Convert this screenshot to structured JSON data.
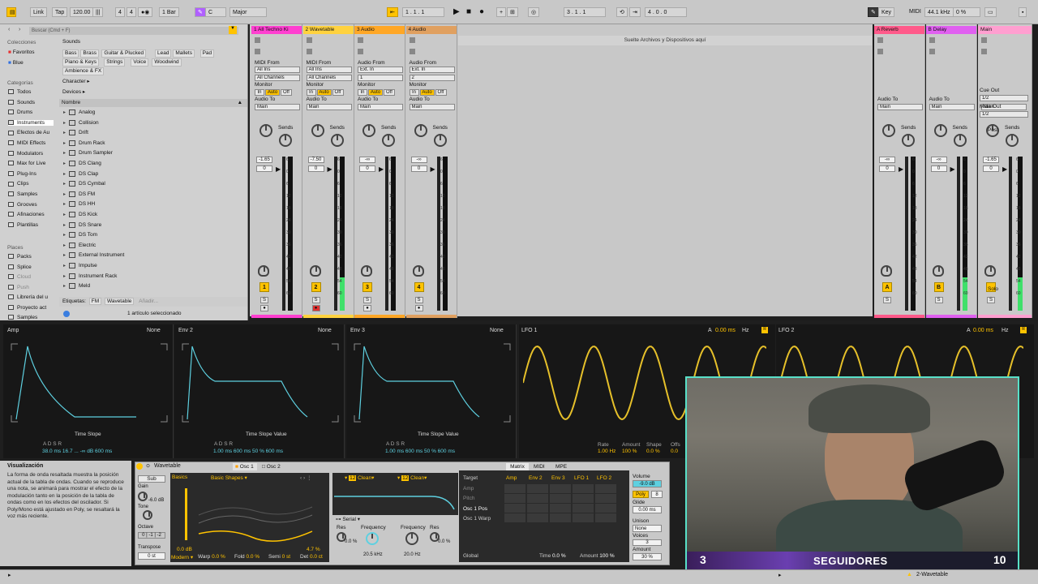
{
  "topbar": {
    "link": "Link",
    "tap": "Tap",
    "tempo": "120.00",
    "meter_num": "4",
    "meter_den": "4",
    "quant": "1 Bar",
    "key": "C",
    "scale": "Major",
    "pos1": "1 .    1 .    1",
    "pos2": "3 .    1 .    1",
    "pos3": "4 .    0 .    0",
    "key_label": "Key",
    "midi_label": "MIDI",
    "samplerate": "44.1 kHz",
    "cpu": "0 %"
  },
  "browser": {
    "search_placeholder": "Buscar (Cmd + F)",
    "headers": {
      "colecciones": "Colecciones",
      "categorias": "Categorías",
      "places": "Places"
    },
    "collections": [
      "Favoritos",
      "Blue"
    ],
    "collection_colors": [
      "#e83030",
      "#3070e0"
    ],
    "categories": [
      "Todos",
      "Sounds",
      "Drums",
      "Instruments",
      "Efectos de Au",
      "MIDI Effects",
      "Modulators",
      "Max for Live",
      "Plug-Ins",
      "Clips",
      "Samples",
      "Grooves",
      "Afinaciones",
      "Plantillas"
    ],
    "places": [
      "Packs",
      "Splice",
      "Cloud",
      "Push",
      "Librería del u",
      "Proyecto act",
      "Samples"
    ],
    "sounds_label": "Sounds",
    "chips_row1": [
      "Bass",
      "Brass",
      "Guitar & Plucked",
      "Lead",
      "Mallets",
      "Pad"
    ],
    "chips_row2": [
      "Piano & Keys",
      "Strings",
      "Voice",
      "Woodwind"
    ],
    "chips_row3": [
      "Ambience & FX"
    ],
    "character": "Character",
    "devices": "Devices",
    "name_col": "Nombre",
    "items": [
      "Analog",
      "Collision",
      "Drift",
      "Drum Rack",
      "Drum Sampler",
      "DS Clang",
      "DS Clap",
      "DS Cymbal",
      "DS FM",
      "DS HH",
      "DS Kick",
      "DS Snare",
      "DS Tom",
      "Electric",
      "External Instrument",
      "Impulse",
      "Instrument Rack",
      "Meld"
    ],
    "tags_label": "Etiquetas:",
    "tag1": "FM",
    "tag2": "Wavetable",
    "tag_add": "Añadir...",
    "selected": "1 artículo seleccionado"
  },
  "session": {
    "dropzone": "Suelte Archivos y Dispositivos aquí",
    "tracks": [
      {
        "name": "1 All Techno Ki",
        "color": "#ff3fd0",
        "from_label": "MIDI From",
        "from": "All Ins",
        "ch": "All Channels",
        "vol": "-1.65",
        "pan": "0",
        "num": "1"
      },
      {
        "name": "2 Wavetable",
        "color": "#ffd23f",
        "from_label": "MIDI From",
        "from": "All Ins",
        "ch": "All Channels",
        "vol": "-7.50",
        "pan": "0",
        "num": "2"
      },
      {
        "name": "3 Audio",
        "color": "#ffa726",
        "from_label": "Audio From",
        "from": "Ext. In",
        "ch": "1",
        "vol": "-∞",
        "pan": "0",
        "num": "3"
      },
      {
        "name": "4 Audio",
        "color": "#e0a060",
        "from_label": "Audio From",
        "from": "Ext. In",
        "ch": "2",
        "vol": "-∞",
        "pan": "0",
        "num": "4"
      }
    ],
    "returns": [
      {
        "name": "A Reverb",
        "color": "#ff5a8a",
        "vol": "-∞",
        "pan": "0",
        "num": "A"
      },
      {
        "name": "B Delay",
        "color": "#e060f0",
        "vol": "-∞",
        "pan": "0",
        "num": "B"
      }
    ],
    "main": {
      "name": "Main",
      "color": "#ff9fd0",
      "vol": "-1.65",
      "pan": "0",
      "cue_out": "Cue Out",
      "cue_val": "1/2",
      "main_out": "Main Out",
      "main_val": "1/2",
      "post": "Post",
      "solo": "Solo"
    },
    "monitor": "Monitor",
    "in": "In",
    "auto": "Auto",
    "off": "Off",
    "audio_to": "Audio To",
    "main_dest": "Main",
    "sends": "Sends",
    "s": "S",
    "scale": [
      "6",
      "0",
      "6",
      "12",
      "18",
      "24",
      "30",
      "36",
      "42",
      "48",
      "54",
      "60"
    ]
  },
  "devices": {
    "amp": {
      "title": "Amp",
      "none": "None",
      "labels": "Time   Slope",
      "adsr": "A        D       S        R",
      "vals": "38.0 ms   16.7 ...  -∞ dB      600 ms"
    },
    "env2": {
      "title": "Env 2",
      "none": "None",
      "labels": "Time   Slope   Value",
      "adsr": "A        D       S        R",
      "vals": "1.00 ms  600 ms   50 %     600 ms"
    },
    "env3": {
      "title": "Env 3",
      "none": "None",
      "labels": "Time   Slope   Value",
      "adsr": "A        D       S        R",
      "vals": "1.00 ms  600 ms   50 %     600 ms"
    },
    "lfo1": {
      "title": "LFO 1",
      "a": "A",
      "ms": "0.00 ms",
      "hz": "Hz",
      "rate": "Rate",
      "amount": "Amount",
      "shape": "Shape",
      "offset": "Offs",
      "rate_v": "1.00 Hz",
      "amount_v": "100 %",
      "shape_v": "0.0 %",
      "offset_v": "0.0"
    },
    "lfo2": {
      "title": "LFO 2",
      "a": "A",
      "ms": "0.00 ms",
      "hz": "Hz"
    }
  },
  "info": {
    "title": "Visualización",
    "text": "La forma de onda resaltada muestra la posición actual de la tabla de ondas. Cuando se reproduce una nota, se animará para mostrar el efecto de la modulación tanto en la posición de la tabla de ondas como en los efectos del oscilador. Si Poly/Mono está ajustado en Poly, se resaltará la voz más reciente."
  },
  "wavetable": {
    "title": "Wavetable",
    "osc1": "Osc 1",
    "osc2": "Osc 2",
    "sub": "Sub",
    "gain": "Gain",
    "gain_v": "-6.0 dB",
    "tone": "Tone",
    "octave": "Octave",
    "transpose": "Transpose",
    "transpose_v": "0 st",
    "basics": "Basics",
    "basic_shapes": "Basic Shapes",
    "db": "0.0 dB",
    "modern": "Modern",
    "warp": "Warp",
    "warp_v": "0.0 %",
    "fold": "Fold",
    "fold_v": "0.0 %",
    "semi": "Semi",
    "semi_v": "0 st",
    "det": "Det",
    "det_v": "0.0 ct",
    "pct": "4.7 %",
    "clean1": "Clean",
    "clean2": "Clean",
    "twelve": "12",
    "serial": "Serial",
    "res": "Res",
    "res_v": "0.0 %",
    "freq": "Frequency",
    "freq_v": "20.5 kHz",
    "freq2_v": "20.0 Hz",
    "target": "Target",
    "amp": "Amp",
    "pitch": "Pitch",
    "osc1pos": "Osc 1 Pos",
    "osc1warp": "Osc 1 Warp",
    "global": "Global",
    "matrix": "Matrix",
    "midi": "MIDI",
    "mpe": "MPE",
    "cols": [
      "Amp",
      "Env 2",
      "Env 3",
      "LFO 1",
      "LFO 2"
    ],
    "time": "Time",
    "time_v": "0.0 %",
    "amount": "Amount",
    "amount_v": "100 %",
    "volume": "Volume",
    "volume_v": "-9.0 dB",
    "poly": "Poly",
    "poly_n": "8",
    "glide": "Glide",
    "glide_v": "0.00 ms",
    "unison": "Unison",
    "unison_v": "None",
    "voices": "Voices",
    "voices_v": "3",
    "amount2": "Amount",
    "amount2_v": "30 %"
  },
  "overlay": {
    "left": "3",
    "label": "SEGUIDORES",
    "right": "10"
  },
  "statusbar": {
    "track": "2-Wavetable"
  }
}
